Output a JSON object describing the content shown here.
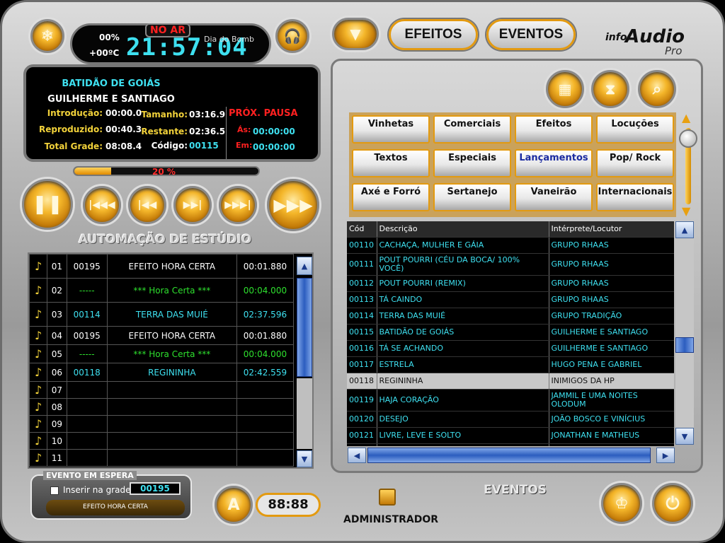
{
  "player": {
    "volume": "00%",
    "temperature": "+00ºC",
    "on_air": "NO AR",
    "clock": "21:57:04",
    "greeting": "Dia do Bomb",
    "current_title": "BATIDÃO DE GOIÁS",
    "current_artist": "GUILHERME E SANTIAGO",
    "intro_label": "Introdução:",
    "intro_value": "00:00.0",
    "played_label": "Reproduzido:",
    "played_value": "00:40.3",
    "total_label": "Total Grade:",
    "total_value": "08:08.4",
    "size_label": "Tamanho:",
    "size_value": "03:16.9",
    "remaining_label": "Restante:",
    "remaining_value": "02:36.5",
    "code_label": "Código:",
    "code_value": "00115",
    "next_pause_label": "PRÓX. PAUSA",
    "at_label": "Ás:",
    "at_value": "00:00:00",
    "in_label": "Em:",
    "in_value": "00:00:00",
    "progress": 0.2,
    "progress_label": "20 %"
  },
  "section_title": "AUTOMAÇÃO DE ESTÚDIO",
  "playlist": [
    {
      "n": "01",
      "code": "00195",
      "title": "EFEITO HORA CERTA",
      "time": "00:01.880",
      "type": "w"
    },
    {
      "n": "02",
      "code": "-----",
      "title": "*** Hora Certa ***",
      "time": "00:04.000",
      "type": "g"
    },
    {
      "n": "03",
      "code": "00114",
      "title": "TERRA DAS MUIÉ",
      "time": "02:37.596",
      "type": "c"
    },
    {
      "n": "04",
      "code": "00195",
      "title": "EFEITO HORA CERTA",
      "time": "00:01.880",
      "type": "w"
    },
    {
      "n": "05",
      "code": "-----",
      "title": "*** Hora Certa ***",
      "time": "00:04.000",
      "type": "g"
    },
    {
      "n": "06",
      "code": "00118",
      "title": "REGININHA",
      "time": "02:42.559",
      "type": "c"
    },
    {
      "n": "07",
      "code": "",
      "title": "",
      "time": "",
      "type": "w"
    },
    {
      "n": "08",
      "code": "",
      "title": "",
      "time": "",
      "type": "w"
    },
    {
      "n": "09",
      "code": "",
      "title": "",
      "time": "",
      "type": "w"
    },
    {
      "n": "10",
      "code": "",
      "title": "",
      "time": "",
      "type": "w"
    },
    {
      "n": "11",
      "code": "",
      "title": "",
      "time": "",
      "type": "w"
    }
  ],
  "waiting": {
    "title": "EVENTO EM ESPERA",
    "checkbox_label": "Inserir na grade",
    "code": "00195",
    "name": "EFEITO HORA CERTA"
  },
  "bottom": {
    "a_label": "A",
    "timer": "88:88",
    "admin_label": "ADMINISTRADOR",
    "events_label": "EVENTOS"
  },
  "top_buttons": {
    "efeitos": "EFEITOS",
    "eventos": "EVENTOS"
  },
  "logo": {
    "info": "info",
    "audio": "Audio",
    "pro": "Pro"
  },
  "categories": [
    "Vinhetas",
    "Comerciais",
    "Efeitos",
    "Locuções",
    "Textos",
    "Especiais",
    "Lançamentos",
    "Pop/ Rock",
    "Axé e Forró",
    "Sertanejo",
    "Vaneirão",
    "Internacionais"
  ],
  "selected_category": "Lançamentos",
  "library": {
    "headers": [
      "Cód",
      "Descrição",
      "Intérprete/Locutor"
    ],
    "rows": [
      [
        "00110",
        "CACHAÇA, MULHER E GÁIA",
        "GRUPO RHAAS"
      ],
      [
        "00111",
        "POUT POURRI (CÉU DA BOCA/ 100% VOCÊ)",
        "GRUPO RHAAS"
      ],
      [
        "00112",
        "POUT POURRI (REMIX)",
        "GRUPO RHAAS"
      ],
      [
        "00113",
        "TÁ CAINDO",
        "GRUPO RHAAS"
      ],
      [
        "00114",
        "TERRA DAS MUIÉ",
        "GRUPO TRADIÇÃO"
      ],
      [
        "00115",
        "BATIDÃO DE GOIÁS",
        "GUILHERME E SANTIAGO"
      ],
      [
        "00116",
        "TÁ SE ACHANDO",
        "GUILHERME E SANTIAGO"
      ],
      [
        "00117",
        "ESTRELA",
        "HUGO PENA E GABRIEL"
      ],
      [
        "00118",
        "REGININHA",
        "INIMIGOS DA HP"
      ],
      [
        "00119",
        "HAJA CORAÇÃO",
        "JAMMIL E UMA NOITES OLODUM"
      ],
      [
        "00120",
        "DESEJO",
        "JOÃO BOSCO E VINÍCIUS"
      ],
      [
        "00121",
        "LIVRE, LEVE E SOLTO",
        "JONATHAN E MATHEUS"
      ],
      [
        "",
        "",
        "JONATHAN E MATHEUS"
      ]
    ],
    "selected_index": 8
  },
  "colors": {
    "accent": "#f0a818",
    "cyan": "#3ee0f0",
    "green": "#2ee02e",
    "red": "#ff2020"
  }
}
